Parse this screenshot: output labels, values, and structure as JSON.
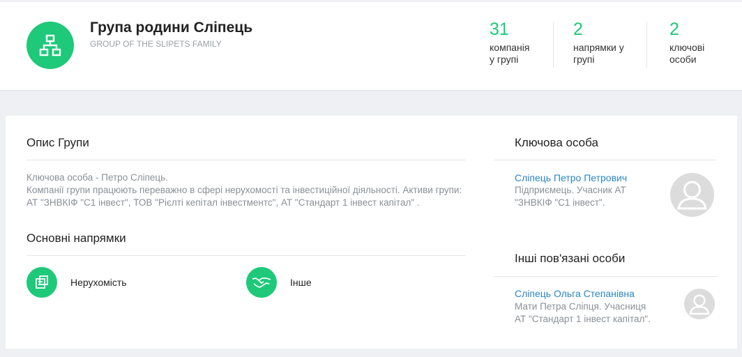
{
  "group": {
    "title": "Група родини Сліпець",
    "subtitle": "GROUP OF THE SLIPETS FAMILY",
    "icon": "org-structure-icon"
  },
  "stats": [
    {
      "value": "31",
      "label_line1": "компанія",
      "label_line2": "у групі"
    },
    {
      "value": "2",
      "label_line1": "напрямки у",
      "label_line2": "групі"
    },
    {
      "value": "2",
      "label_line1": "ключові",
      "label_line2": "особи"
    }
  ],
  "description": {
    "heading": "Опис Групи",
    "line1": "Ключова особа - Петро Сліпець.",
    "line2": "Компанії групи працюють переважно в сфері нерухомості та інвестиційної діяльності. Активи групи: АТ \"ЗНВКІФ \"С1 інвест\", ТОВ \"Рієлті кепітал інвестментс\", АТ \"Стандарт 1 інвест капітал\" ."
  },
  "directions": {
    "heading": "Основні напрямки",
    "items": [
      {
        "label": "Нерухомість",
        "icon": "building-plan-icon"
      },
      {
        "label": "Інше",
        "icon": "handshake-icon"
      }
    ]
  },
  "key_person": {
    "heading": "Ключова особа",
    "name": "Сліпець Петро Петрович",
    "desc_line1": "Підприємець. Учасник АТ",
    "desc_line2": "\"ЗНВКІФ \"С1 інвест\"."
  },
  "related": {
    "heading": "Інші пов'язані особи",
    "name": "Сліпець Ольга Степанівна",
    "desc_line1": "Мати Петра Сліпця. Учасниця",
    "desc_line2": "АТ \"Стандарт 1 інвест капітал\"."
  },
  "colors": {
    "accent": "#1ec979",
    "link": "#2a86c6",
    "muted": "#8a8f95"
  }
}
